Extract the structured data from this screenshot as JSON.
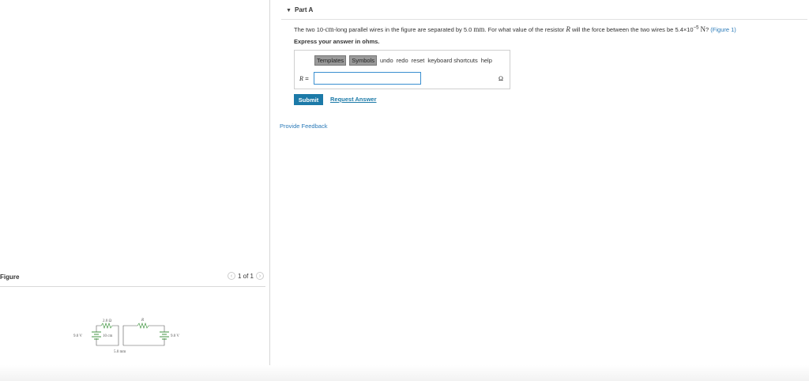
{
  "figure_panel": {
    "label": "Figure",
    "pager_text": "1 of 1",
    "prev_icon": "chevron-left-icon",
    "next_icon": "chevron-right-icon",
    "circuit": {
      "left_battery": "9.0 V",
      "left_resistor": "2.0 Ω",
      "wire_length": "10 cm",
      "right_resistor": "R",
      "right_battery": "9.0 V",
      "separation": "5.0 mm"
    }
  },
  "part": {
    "title": "Part A",
    "caret_icon": "caret-down-icon",
    "question": {
      "text_1": "The two 10-",
      "unit_cm": "cm",
      "text_2": "-long parallel wires in the figure are separated by 5.0 ",
      "unit_mm": "mm",
      "text_3": ". For what value of the resistor ",
      "symbol_R": "R",
      "text_4": " will the force between the two wires be 5.4×10",
      "exponent": "−5",
      "unit_N": "N",
      "text_5": "? ",
      "figure_link": "(Figure 1)"
    },
    "instruction": "Express your answer in ohms."
  },
  "answer": {
    "toolbar": {
      "templates": "Templates",
      "symbols": "Symbols",
      "undo": "undo",
      "redo": "redo",
      "reset": "reset",
      "shortcuts": "keyboard shortcuts",
      "help": "help"
    },
    "label_symbol": "R",
    "label_eq": " =",
    "input_value": "",
    "unit": "Ω"
  },
  "actions": {
    "submit": "Submit",
    "request": "Request Answer",
    "feedback": "Provide Feedback"
  }
}
